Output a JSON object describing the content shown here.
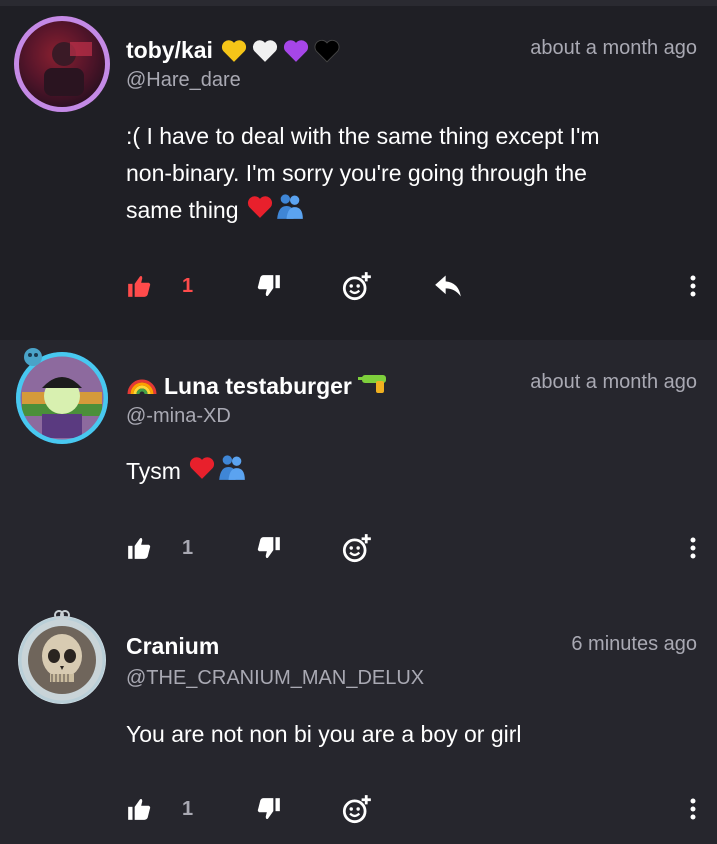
{
  "comments": [
    {
      "name": "toby/kai",
      "handle": "@Hare_dare",
      "time": "about a month ago",
      "text_lines": [
        ":( I have to deal with the same thing  except I'm",
        "non-binary. I'm sorry you're going through the",
        "same thing"
      ],
      "likes": "1",
      "liked": true,
      "has_reply": true
    },
    {
      "name": "Luna testaburger",
      "handle": "@-mina-XD",
      "time": "about a month ago",
      "text_lines": [
        "Tysm"
      ],
      "likes": "1",
      "liked": false,
      "has_reply": false
    },
    {
      "name": "Cranium",
      "handle": "@THE_CRANIUM_MAN_DELUX",
      "time": "6 minutes ago",
      "text_lines": [
        "You are not non bi you are a boy or girl"
      ],
      "likes": "1",
      "liked": false,
      "has_reply": false
    }
  ],
  "colors": {
    "like_active": "#ff4b4b",
    "icon": "#ffffff",
    "muted": "#a9a9b3"
  },
  "icons": [
    "thumbs-up-icon",
    "thumbs-down-icon",
    "add-reaction-icon",
    "reply-icon",
    "more-vertical-icon"
  ]
}
